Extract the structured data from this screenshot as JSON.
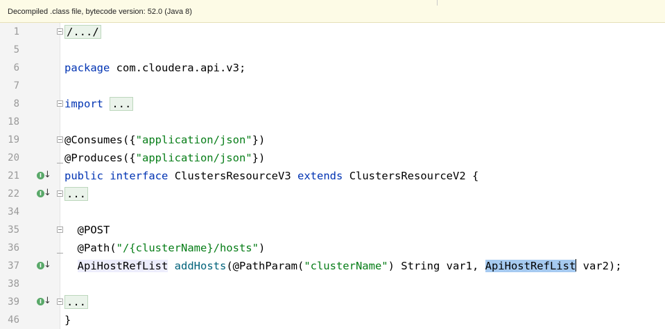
{
  "banner": {
    "text": "Decompiled .class file, bytecode version: 52.0 (Java 8)"
  },
  "lines": [
    {
      "num": "1"
    },
    {
      "num": "5"
    },
    {
      "num": "6"
    },
    {
      "num": "7"
    },
    {
      "num": "8"
    },
    {
      "num": "18"
    },
    {
      "num": "19"
    },
    {
      "num": "20"
    },
    {
      "num": "21"
    },
    {
      "num": "22"
    },
    {
      "num": "34"
    },
    {
      "num": "35"
    },
    {
      "num": "36"
    },
    {
      "num": "37"
    },
    {
      "num": "38"
    },
    {
      "num": "39"
    },
    {
      "num": "46"
    }
  ],
  "code": {
    "l1_folded": "/.../",
    "l6_kw": "package",
    "l6_rest": " com.cloudera.api.v3;",
    "l8_kw": "import",
    "l8_folded": "...",
    "l19_ann": "@Consumes({",
    "l19_str": "\"application/json\"",
    "l19_end": "})",
    "l20_ann": "@Produces({",
    "l20_str": "\"application/json\"",
    "l20_end": "})",
    "l21_kw1": "public",
    "l21_kw2": "interface",
    "l21_name": "ClustersResourceV3",
    "l21_kw3": "extends",
    "l21_parent": "ClustersResourceV2 {",
    "l22_folded": "...",
    "l35_ann": "@POST",
    "l36_ann": "@Path(",
    "l36_str": "\"/{clusterName}/hosts\"",
    "l36_end": ")",
    "l37_type": "ApiHostRefList",
    "l37_method": "addHosts",
    "l37_open": "(@PathParam(",
    "l37_str": "\"clusterName\"",
    "l37_mid": ") String var1, ",
    "l37_sel": "ApiHostRefList",
    "l37_end": " var2);",
    "l39_folded": "...",
    "l46_close": "}"
  },
  "icons": {
    "implemented": "implemented-method-icon",
    "fold": "fold-icon"
  },
  "colors": {
    "keyword": "#0033b3",
    "string": "#067d17",
    "method": "#00627a",
    "selection": "#a6caf0"
  }
}
